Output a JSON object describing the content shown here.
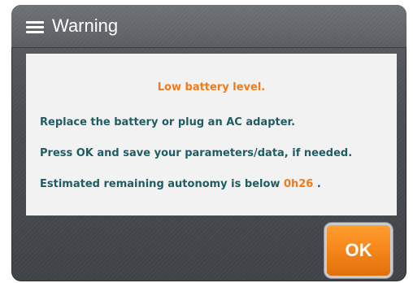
{
  "window": {
    "title": "Warning",
    "menu_icon": "hamburger-menu-icon"
  },
  "message": {
    "headline": "Low battery level.",
    "line1": "Replace the battery or plug an AC adapter.",
    "line2": "Press OK and save your parameters/data, if needed.",
    "line3_prefix": "Estimated remaining autonomy is below",
    "line3_value": "0h26",
    "line3_suffix": "."
  },
  "buttons": {
    "ok_label": "OK"
  },
  "colors": {
    "accent": "#f07b1c",
    "text": "#1f5c63",
    "panel": "#f2f2f2",
    "frame": "#4a4e52"
  }
}
